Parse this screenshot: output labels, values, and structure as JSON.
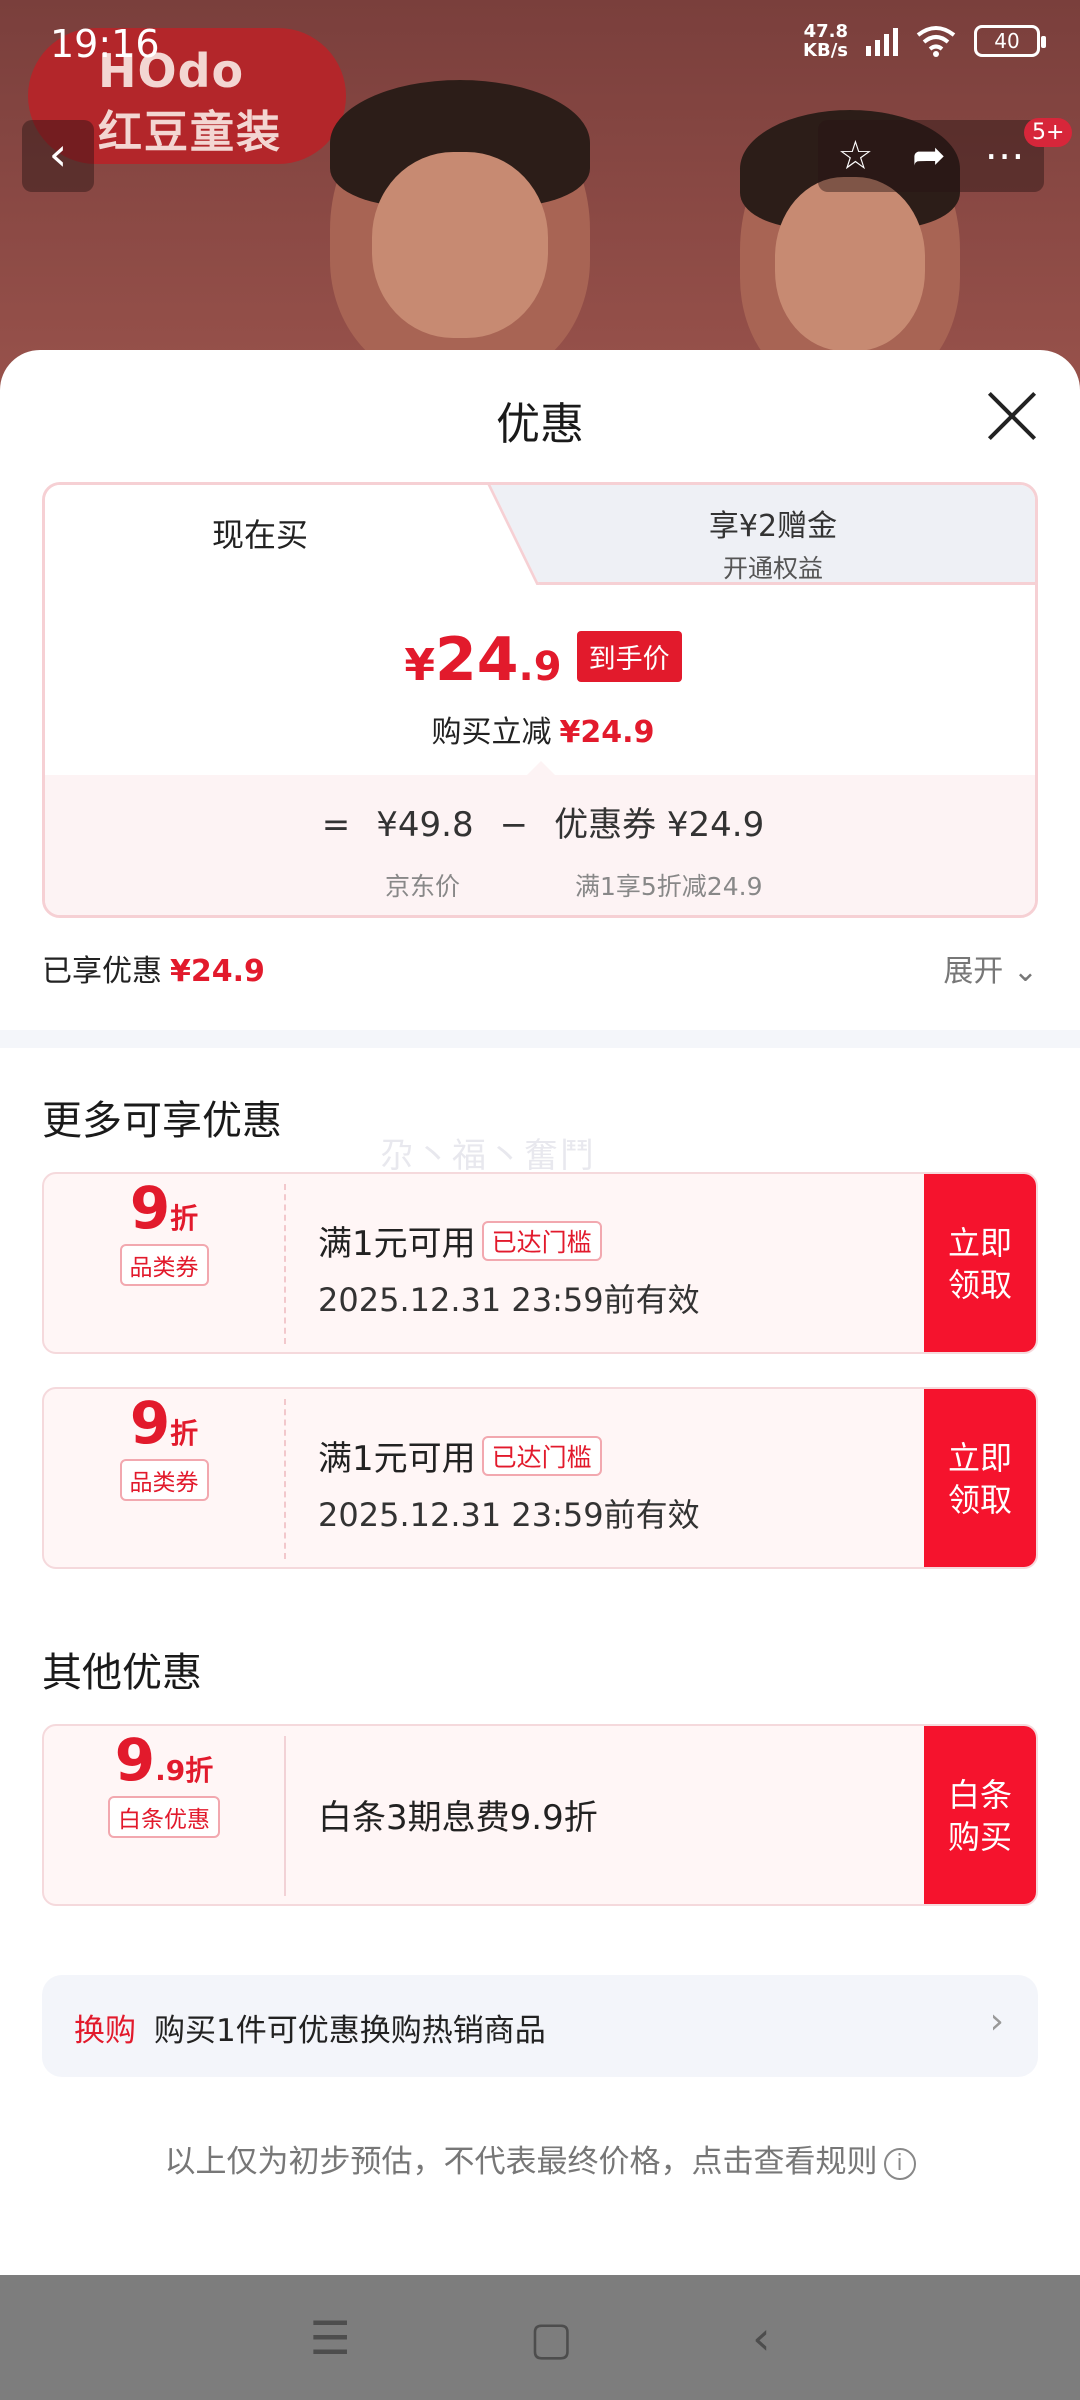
{
  "status": {
    "time": "19:16",
    "speed_value": "47.8",
    "speed_unit": "KB/s",
    "battery": "40"
  },
  "hero": {
    "brand_en": "HOdo",
    "brand_cn": "红豆童装",
    "cart_badge": "5+"
  },
  "sheet": {
    "title": "优惠",
    "tabs": {
      "buy_now": "现在买",
      "gift_title": "享¥2赠金",
      "gift_sub": "开通权益"
    },
    "price": {
      "yen": "¥",
      "integer": "24",
      "decimal": ".9",
      "tag": "到手价"
    },
    "reduce": {
      "label": "购买立减",
      "value": "¥24.9"
    },
    "calc": {
      "equals": "=",
      "jd_price": "¥49.8",
      "minus": "−",
      "coupon_label": "优惠券",
      "coupon_value": "¥24.9",
      "jd_price_label": "京东价",
      "coupon_note": "满1享5折减24.9"
    },
    "enjoyed": {
      "label": "已享优惠",
      "value": "¥24.9",
      "expand": "展开"
    },
    "more_title": "更多可享优惠",
    "watermark": "尕丶福丶奮鬥",
    "coupons": [
      {
        "num": "9",
        "unit": "折",
        "type": "品类券",
        "cond": "满1元可用",
        "chip": "已达门槛",
        "valid": "2025.12.31 23:59前有效",
        "button": "立即领取"
      },
      {
        "num": "9",
        "unit": "折",
        "type": "品类券",
        "cond": "满1元可用",
        "chip": "已达门槛",
        "valid": "2025.12.31 23:59前有效",
        "button": "立即领取"
      }
    ],
    "other_title": "其他优惠",
    "baitiao": {
      "num": "9",
      "unit": ".9折",
      "type": "白条优惠",
      "desc": "白条3期息费9.9折",
      "button": "白条购买"
    },
    "swap": {
      "key": "换购",
      "text": "购买1件可优惠换购热销商品"
    },
    "footnote": "以上仅为初步预估，不代表最终价格，点击查看规则"
  },
  "colors": {
    "accent": "#e21a2c",
    "button_red": "#f5132d"
  }
}
